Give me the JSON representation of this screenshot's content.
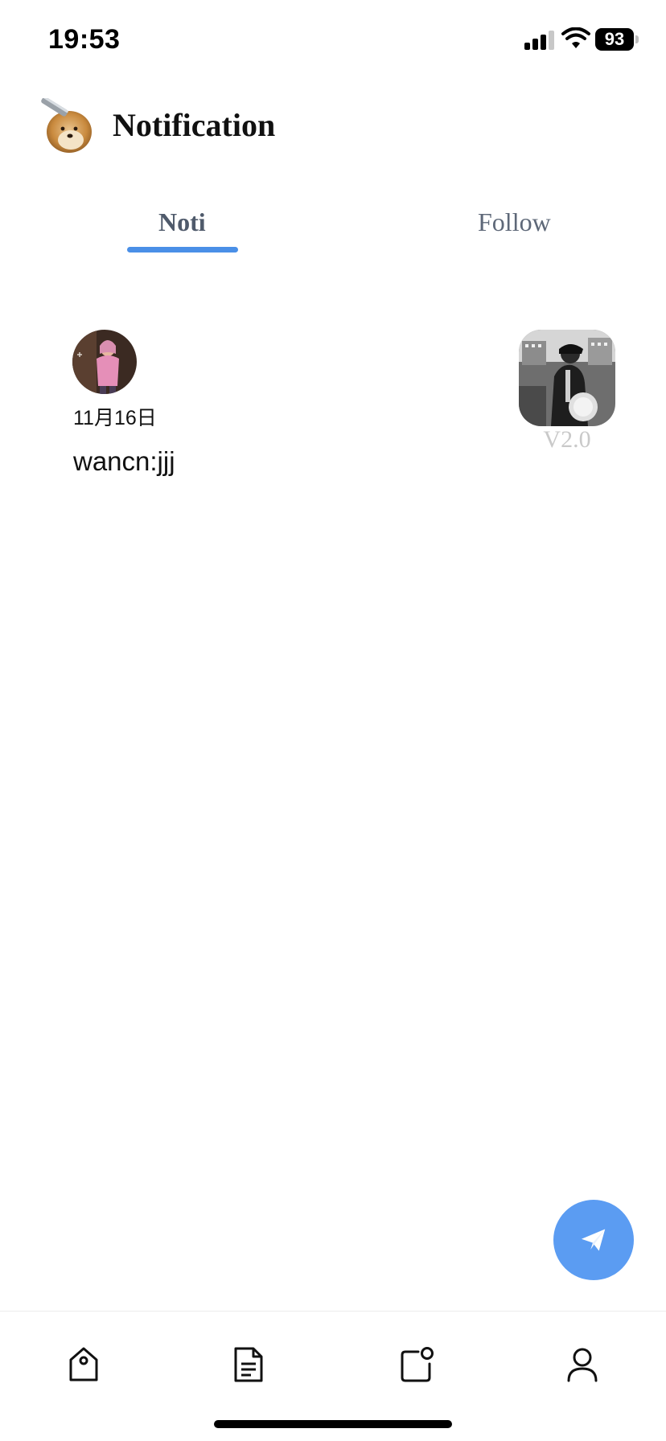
{
  "status_bar": {
    "time": "19:53",
    "battery": "93",
    "icons": [
      "signal-icon",
      "wifi-icon",
      "battery-icon"
    ]
  },
  "header": {
    "title": "Notification",
    "logo": "shiba-dog-logo"
  },
  "tabs": [
    {
      "label": "Noti",
      "active": true
    },
    {
      "label": "Follow",
      "active": false
    }
  ],
  "notifications": [
    {
      "date": "11月16日",
      "text": "wancn:jjj",
      "version": "V2.0"
    }
  ],
  "fab": {
    "icon": "send-icon"
  },
  "bottom_nav": {
    "items": [
      {
        "icon": "tag-icon"
      },
      {
        "icon": "document-icon"
      },
      {
        "icon": "notification-icon"
      },
      {
        "icon": "profile-icon"
      }
    ]
  },
  "colors": {
    "accent": "#4a8fe7",
    "fab": "#5b9cf2",
    "tab_text": "#5b6678",
    "version_text": "#c9c9c9"
  }
}
